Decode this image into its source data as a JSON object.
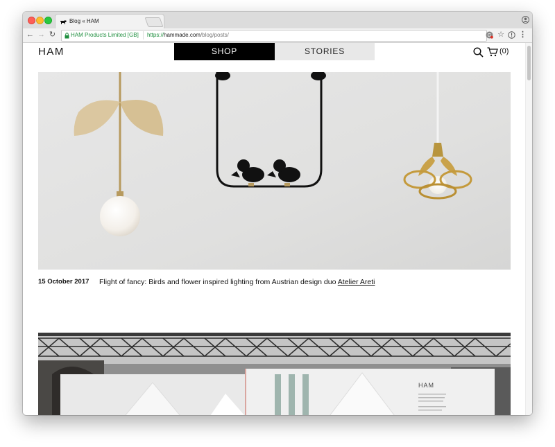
{
  "browser": {
    "tab_title": "Blog « HAM",
    "tab_close": "×",
    "secure_label": "HAM Products Limited [GB]",
    "url_scheme": "https://",
    "url_host": "hammade.com",
    "url_path": "/blog/posts/",
    "nav_back": "←",
    "nav_forward": "→",
    "nav_reload": "↻",
    "star": "☆",
    "menu": "⋮"
  },
  "site": {
    "logo": "HAM",
    "nav": {
      "shop": "SHOP",
      "stories": "STORIES"
    },
    "cart_count": "(0)"
  },
  "posts": [
    {
      "date": "15 October 2017",
      "title": "Flight of fancy: Birds and flower inspired lighting from Austrian design duo ",
      "link_text": "Atelier Areti"
    }
  ],
  "second_post": {
    "sign_text": "HAM"
  },
  "colors": {
    "shop_bg": "#000000",
    "stories_bg": "#e8e8e8",
    "secure_green": "#1e8e3e"
  },
  "icons": [
    "search-icon",
    "cart-icon",
    "lock-icon",
    "star-icon",
    "menu-icon",
    "profile-icon"
  ]
}
